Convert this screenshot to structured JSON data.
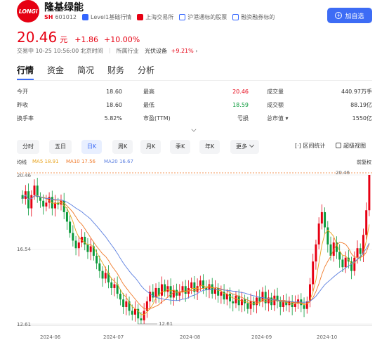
{
  "header": {
    "logo_text": "LONGi",
    "name": "隆基绿能",
    "exchange_tag": "SH",
    "code": "601012",
    "tags": [
      "Level1基础行情",
      "上海交易所",
      "沪港通标的股票",
      "融资融券标的"
    ],
    "add_button": "加自选"
  },
  "price": {
    "last": "20.46",
    "unit": "元",
    "change": "+1.86",
    "change_pct": "+10.00%"
  },
  "status": {
    "state": "交易中 10-25 10:56:00 北京时间",
    "industry_label": "所属行业",
    "industry_name": "光伏设备",
    "industry_pct": "+9.21%"
  },
  "tabs": [
    "行情",
    "资金",
    "简况",
    "财务",
    "分析"
  ],
  "quotes": [
    [
      {
        "label": "今开",
        "value": "18.60",
        "tone": ""
      },
      {
        "label": "最高",
        "value": "20.46",
        "tone": "up"
      },
      {
        "label": "成交量",
        "value": "440.97万手",
        "tone": ""
      }
    ],
    [
      {
        "label": "昨收",
        "value": "18.60",
        "tone": ""
      },
      {
        "label": "最低",
        "value": "18.59",
        "tone": "down"
      },
      {
        "label": "成交额",
        "value": "88.19亿",
        "tone": ""
      }
    ],
    [
      {
        "label": "换手率",
        "value": "5.82%",
        "tone": ""
      },
      {
        "label": "市盈(TTM)",
        "value": "亏损",
        "tone": ""
      },
      {
        "label": "总市值 ▾",
        "value": "1550亿",
        "tone": ""
      }
    ]
  ],
  "periods": [
    "分时",
    "五日",
    "日K",
    "周K",
    "月K",
    "季K",
    "年K",
    "更多"
  ],
  "tools": {
    "interval": "区间统计",
    "super": "超级视图"
  },
  "ma": {
    "label": "均线",
    "ma5": "MA5 18.91",
    "ma10": "MA10 17.56",
    "ma20": "MA20 16.67",
    "adjust": "前复权"
  },
  "colors": {
    "up": "#e60012",
    "down": "#0a9a3a",
    "accent": "#3d6cf5",
    "ma5": "#e8a21a",
    "ma10": "#f07a2a",
    "ma20": "#5b7fe0"
  },
  "chart_data": {
    "type": "candlestick",
    "y_ticks": [
      "20.46",
      "16.54",
      "12.61"
    ],
    "ylim": [
      12.61,
      20.46
    ],
    "x_ticks": [
      "2024-06",
      "2024-07",
      "2024-08",
      "2024-09",
      "2024-10"
    ],
    "max_label": "20.46",
    "min_label": "12.61",
    "closes": [
      19.2,
      19.6,
      18.7,
      19.4,
      19.9,
      19.3,
      19.1,
      18.8,
      19.0,
      19.3,
      18.7,
      19.0,
      18.9,
      19.1,
      18.5,
      18.0,
      17.4,
      17.0,
      16.6,
      16.9,
      17.2,
      16.8,
      16.4,
      16.7,
      16.2,
      15.8,
      15.4,
      15.0,
      15.3,
      14.8,
      14.5,
      14.7,
      14.2,
      13.9,
      13.5,
      13.8,
      13.3,
      13.1,
      13.4,
      12.9,
      12.8,
      13.3,
      13.8,
      14.3,
      14.0,
      14.5,
      14.1,
      14.7,
      14.3,
      14.6,
      14.0,
      14.4,
      14.1,
      14.3,
      14.6,
      14.2,
      14.5,
      14.8,
      14.3,
      14.6,
      14.9,
      14.5,
      14.4,
      14.7,
      14.2,
      14.5,
      14.1,
      14.3,
      13.9,
      14.2,
      13.8,
      13.7,
      14.1,
      13.6,
      13.9,
      13.7,
      13.4,
      13.8,
      13.6,
      14.0,
      13.8,
      14.3,
      13.7,
      14.0,
      13.6,
      14.1,
      13.8,
      13.5,
      13.8,
      13.6,
      13.8,
      13.5,
      13.7,
      13.9,
      13.6,
      13.4,
      13.8,
      14.7,
      15.9,
      16.8,
      17.9,
      18.5,
      17.7,
      16.8,
      16.2,
      16.9,
      16.4,
      16.0,
      15.6,
      16.1,
      15.9,
      15.4,
      16.1,
      16.6,
      16.3,
      17.3,
      18.6,
      20.46
    ]
  }
}
